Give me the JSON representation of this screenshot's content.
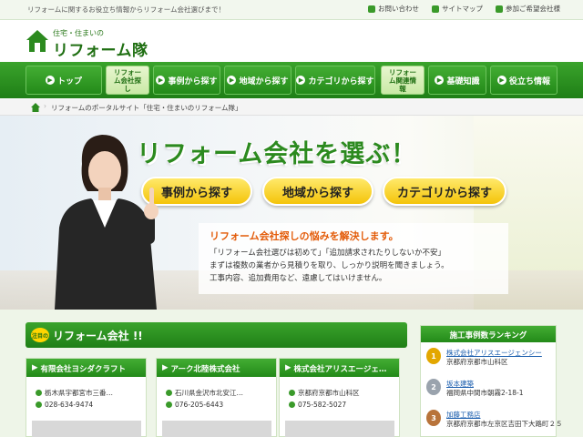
{
  "topbar": {
    "tagline": "リフォームに関するお役立ち情報からリフォーム会社選びまで！",
    "links": [
      {
        "label": "お問い合わせ",
        "icon": "mail-icon"
      },
      {
        "label": "サイトマップ",
        "icon": "sitemap-icon"
      },
      {
        "label": "参加ご希望会社様",
        "icon": "company-icon"
      }
    ]
  },
  "logo": {
    "sub": "住宅・住まいの",
    "main": "リフォーム隊"
  },
  "nav": [
    {
      "label": "トップ",
      "active": false
    },
    {
      "label": "リフォーム会社探し",
      "active": true
    },
    {
      "label": "事例から探す",
      "active": false
    },
    {
      "label": "地域から探す",
      "active": false
    },
    {
      "label": "カテゴリから探す",
      "active": false
    },
    {
      "label": "リフォーム関連情報",
      "active": true
    },
    {
      "label": "基礎知識",
      "active": false
    },
    {
      "label": "役立ち情報",
      "active": false
    }
  ],
  "breadcrumb": {
    "text": "リフォームのポータルサイト「住宅・住まいのリフォーム隊」"
  },
  "hero": {
    "title": "リフォーム会社を選ぶ！",
    "buttons": [
      "事例から探す",
      "地域から探す",
      "カテゴリから探す"
    ],
    "box_heading": "リフォーム会社探しの悩みを解決します。",
    "box_lines": [
      "「リフォーム会社選びは初めて」「追加請求されたりしないか不安」",
      "まずは複数の業者から見積りを取り、しっかり説明を聞きましょう。",
      "工事内容、追加費用など、遠慮してはいけません。"
    ]
  },
  "section": {
    "badge": "注目の",
    "title": "リフォーム会社 !!"
  },
  "cards": [
    {
      "name": "有限会社ヨシダクラフト",
      "address": "栃木県宇都宮市三番…",
      "phone": "028-634-9474"
    },
    {
      "name": "アーク北陸株式会社",
      "address": "石川県金沢市北安江…",
      "phone": "076-205-6443"
    },
    {
      "name": "株式会社アリスエージェ…",
      "address": "京都府京都市山科区",
      "phone": "075-582-5027"
    }
  ],
  "ranking": {
    "title": "施工事例数ランキング",
    "items": [
      {
        "rank": "1",
        "name": "株式会社アリスエージェンシー",
        "address": "京都府京都市山科区",
        "color": "#e3a700"
      },
      {
        "rank": "2",
        "name": "坂本建築",
        "address": "福岡県中間市朝霧2-18-1",
        "color": "#9aa3ad"
      },
      {
        "rank": "3",
        "name": "加藤工務店",
        "address": "京都府京都市左京区吉田下大路町２５",
        "color": "#b8733a"
      }
    ]
  },
  "colors": {
    "brand_green": "#2c8a1f",
    "accent_yellow": "#f4c40a",
    "accent_orange": "#e35c0a"
  }
}
